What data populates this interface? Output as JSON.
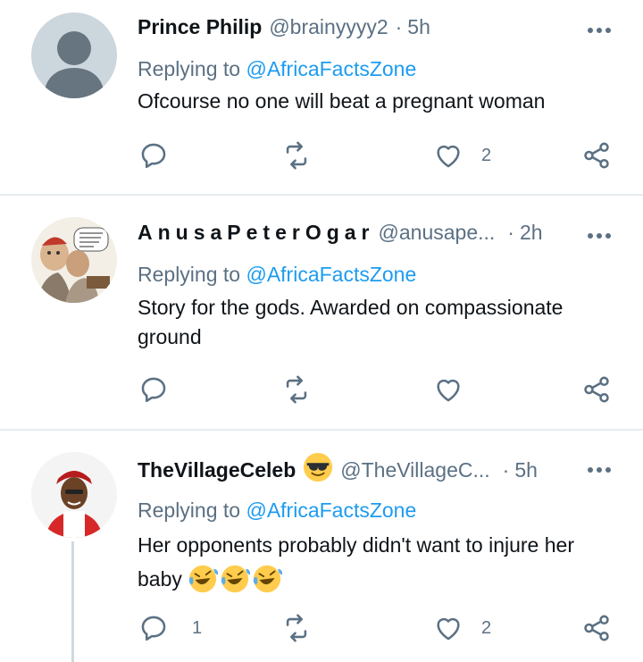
{
  "tweets": [
    {
      "name": "Prince Philip",
      "handle": "@brainyyyy2",
      "time": "5h",
      "replying_prefix": "Replying to",
      "replying_to": "@AfricaFactsZone",
      "text": "Ofcourse no one will beat a pregnant woman",
      "reply_count": "",
      "like_count": "2"
    },
    {
      "name": "AnusaPeterOgar",
      "handle": "@anusape...",
      "time": "2h",
      "replying_prefix": "Replying to",
      "replying_to": "@AfricaFactsZone",
      "text_line1": "Story for the gods. Awarded on compassionate",
      "text_line2": "ground",
      "reply_count": "",
      "like_count": ""
    },
    {
      "name": "TheVillageCeleb",
      "name_emoji": "sunglasses-emoji",
      "handle": "@TheVillageC...",
      "time": "5h",
      "replying_prefix": "Replying to",
      "replying_to": "@AfricaFactsZone",
      "text_line1": "Her opponents probably didn't want to injure her",
      "text_line2": "baby",
      "text_emojis": "laughing-crying-emoji x3",
      "reply_count": "1",
      "like_count": "2"
    }
  ],
  "icons": [
    "reply-icon",
    "retweet-icon",
    "like-icon",
    "share-icon",
    "more-icon"
  ],
  "colors": {
    "accent": "#1d9bf0",
    "secondary": "#5b7083",
    "divider": "#e7ecf0"
  }
}
